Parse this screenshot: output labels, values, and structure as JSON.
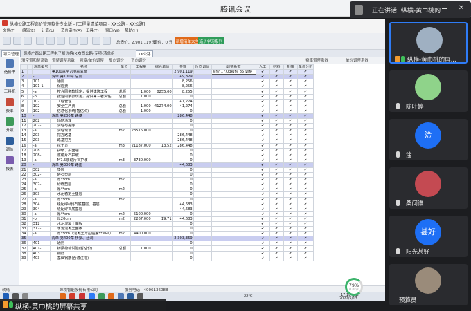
{
  "meeting": {
    "title": "腾讯会议",
    "speaking_label": "正在讲话: 纵横-黄巾桃的..."
  },
  "app": {
    "title": "纵横公路工程造价管理软件专业版 - [工程量清单项目 - XX公路 - XX公路]",
    "menu": [
      "文件(F)",
      "编辑(E)",
      "计算(L)",
      "造价审核(A)",
      "工具(T)",
      "窗口(W)",
      "帮助(H)"
    ],
    "toolbar_total": "总造价：2,901,119 元",
    "toolbar_unit": "调价：0 元",
    "badge_green": "调价助手",
    "badge_orange": "新增清单大全",
    "badge_blue": "造价学习系列",
    "tabs": [
      "项目管理",
      "纵横广西公路工程电子版价格(XX)",
      "广西公路-专项-清单组",
      "XX公路"
    ],
    "filter": [
      "清空调和整系数",
      "调整调整系数",
      "按章/单价调整",
      "反向调价",
      "正向调价"
    ],
    "filter_right": [
      "费率调整系数",
      "单价调整系数"
    ],
    "sidebar": [
      "造价书",
      "工料机",
      "费率",
      "分项",
      "调价",
      "报表"
    ]
  },
  "grid": {
    "headers": [
      "",
      "",
      "清单编号",
      "名称",
      "单位",
      "工程量",
      "综合单价",
      "金额",
      "反向调价",
      "调整系数",
      "人工",
      "材料",
      "机械",
      "单价分析"
    ],
    "adjust_note": "原价   17.03报价   85  调整",
    "rows": [
      {
        "n": "1",
        "code": "",
        "name": "第100章至700章清单",
        "unit": "",
        "qty": "",
        "price": "",
        "amount": "2,901,119",
        "cls": "hl"
      },
      {
        "n": "2",
        "code": "-",
        "name": "清单 第100章 总则",
        "unit": "",
        "qty": "",
        "price": "",
        "amount": "49,829",
        "cls": "sec"
      },
      {
        "n": "3",
        "code": "101",
        "name": "通则",
        "unit": "",
        "qty": "",
        "price": "",
        "amount": "8,256",
        "cls": ""
      },
      {
        "n": "4",
        "code": "101-1",
        "name": "保险费",
        "unit": "",
        "qty": "",
        "price": "",
        "amount": "8,256",
        "cls": ""
      },
      {
        "n": "5",
        "code": "-a",
        "name": "按合同条款规定，提供建筑工程",
        "unit": "总额",
        "qty": "1.000",
        "price": "8255.00",
        "amount": "8,255",
        "cls": ""
      },
      {
        "n": "6",
        "code": "-b",
        "name": "按合同条款规定，提供第三者责任",
        "unit": "总额",
        "qty": "1.000",
        "price": "",
        "amount": "0",
        "cls": ""
      },
      {
        "n": "7",
        "code": "102",
        "name": "工程管理",
        "unit": "",
        "qty": "",
        "price": "",
        "amount": "41,274",
        "cls": ""
      },
      {
        "n": "8",
        "code": "102-",
        "name": "安全生产费",
        "unit": "总额",
        "qty": "1.000",
        "price": "41274.00",
        "amount": "41,274",
        "cls": ""
      },
      {
        "n": "9",
        "code": "102-",
        "name": "信息化系统(暂估价)",
        "unit": "总额",
        "qty": "1.000",
        "price": "",
        "amount": "0",
        "cls": ""
      },
      {
        "n": "10",
        "code": "-",
        "name": "清单 第200章 路基",
        "unit": "",
        "qty": "",
        "price": "",
        "amount": "286,448",
        "cls": "sec"
      },
      {
        "n": "11",
        "code": "202",
        "name": "场地清理",
        "unit": "",
        "qty": "",
        "price": "",
        "amount": "0",
        "cls": ""
      },
      {
        "n": "12",
        "code": "202-",
        "name": "清理与掘除",
        "unit": "",
        "qty": "",
        "price": "",
        "amount": "0",
        "cls": ""
      },
      {
        "n": "13",
        "code": "-a",
        "name": "清理现场",
        "unit": "m2",
        "qty": "23516.000",
        "price": "",
        "amount": "0",
        "cls": ""
      },
      {
        "n": "14",
        "code": "203",
        "name": "挖方路基",
        "unit": "",
        "qty": "",
        "price": "",
        "amount": "286,448",
        "cls": ""
      },
      {
        "n": "15",
        "code": "203-",
        "name": "路基挖方",
        "unit": "",
        "qty": "",
        "price": "",
        "amount": "286,448",
        "cls": ""
      },
      {
        "n": "16",
        "code": "-a",
        "name": "挖土方",
        "unit": "m3",
        "qty": "21187.000",
        "price": "13.52",
        "amount": "286,448",
        "cls": ""
      },
      {
        "n": "17",
        "code": "208",
        "name": "护坡、护面墙",
        "unit": "",
        "qty": "",
        "price": "",
        "amount": "0",
        "cls": ""
      },
      {
        "n": "18",
        "code": "208-",
        "name": "浆砌片石护坡",
        "unit": "",
        "qty": "",
        "price": "",
        "amount": "0",
        "cls": ""
      },
      {
        "n": "19",
        "code": "-a",
        "name": "M7.5浆砌片石护坡",
        "unit": "m3",
        "qty": "3730.000",
        "price": "",
        "amount": "0",
        "cls": ""
      },
      {
        "n": "20",
        "code": "-",
        "name": "清单 第300章 路面",
        "unit": "",
        "qty": "",
        "price": "",
        "amount": "44,683",
        "cls": "sec"
      },
      {
        "n": "21",
        "code": "302",
        "name": "垫层",
        "unit": "",
        "qty": "",
        "price": "",
        "amount": "0",
        "cls": ""
      },
      {
        "n": "22",
        "code": "302-",
        "name": "碎石垫层",
        "unit": "",
        "qty": "",
        "price": "",
        "amount": "0",
        "cls": ""
      },
      {
        "n": "23",
        "code": "-a",
        "name": "厚**cm",
        "unit": "m2",
        "qty": "",
        "price": "",
        "amount": "0",
        "cls": ""
      },
      {
        "n": "24",
        "code": "302-",
        "name": "砂砾垫层",
        "unit": "",
        "qty": "",
        "price": "",
        "amount": "0",
        "cls": ""
      },
      {
        "n": "25",
        "code": "-a",
        "name": "厚**cm",
        "unit": "m2",
        "qty": "",
        "price": "",
        "amount": "0",
        "cls": ""
      },
      {
        "n": "26",
        "code": "303",
        "name": "水泥稳定土垫层",
        "unit": "",
        "qty": "",
        "price": "",
        "amount": "0",
        "cls": ""
      },
      {
        "n": "27",
        "code": "-a",
        "name": "厚**cm",
        "unit": "m2",
        "qty": "",
        "price": "",
        "amount": "0",
        "cls": ""
      },
      {
        "n": "28",
        "code": "304",
        "name": "级配碎(砾)石底基层、基层",
        "unit": "",
        "qty": "",
        "price": "",
        "amount": "44,683",
        "cls": ""
      },
      {
        "n": "29",
        "code": "304-",
        "name": "级配碎石底基层",
        "unit": "",
        "qty": "",
        "price": "",
        "amount": "44,683",
        "cls": ""
      },
      {
        "n": "30",
        "code": "-a",
        "name": "厚**cm",
        "unit": "m2",
        "qty": "5100.000",
        "price": "",
        "amount": "0",
        "cls": ""
      },
      {
        "n": "31",
        "code": "-b",
        "name": "厚20cm",
        "unit": "m2",
        "qty": "2267.000",
        "price": "19.71",
        "amount": "44,683",
        "cls": ""
      },
      {
        "n": "32",
        "code": "312",
        "name": "水泥混凝土面板",
        "unit": "",
        "qty": "",
        "price": "",
        "amount": "0",
        "cls": ""
      },
      {
        "n": "33",
        "code": "312-",
        "name": "水泥混凝土面板",
        "unit": "",
        "qty": "",
        "price": "",
        "amount": "0",
        "cls": ""
      },
      {
        "n": "34",
        "code": "-a",
        "name": "厚**cm（混凝土弯拉强度**MPa）",
        "unit": "m2",
        "qty": "4400.000",
        "price": "",
        "amount": "0",
        "cls": ""
      },
      {
        "n": "35",
        "code": "-",
        "name": "清单 第400章 桥梁、涵洞",
        "unit": "",
        "qty": "",
        "price": "",
        "amount": "2,303,359",
        "cls": "sec"
      },
      {
        "n": "36",
        "code": "401",
        "name": "通则",
        "unit": "",
        "qty": "",
        "price": "",
        "amount": "0",
        "cls": ""
      },
      {
        "n": "37",
        "code": "401-",
        "name": "桥梁荷载试验(暂估价)",
        "unit": "总额",
        "qty": "1.000",
        "price": "",
        "amount": "0",
        "cls": ""
      },
      {
        "n": "38",
        "code": "403",
        "name": "钢筋",
        "unit": "",
        "qty": "",
        "price": "",
        "amount": "0",
        "cls": ""
      },
      {
        "n": "39",
        "code": "403-",
        "name": "基础钢筋(含灌注桩)",
        "unit": "",
        "qty": "",
        "price": "",
        "amount": "0",
        "cls": ""
      }
    ]
  },
  "status": {
    "left": "就绪",
    "company": "纵横智能股份有限公司",
    "phone": "服务电话：4006136088"
  },
  "taskbar": {
    "weather": "22°C",
    "time": "17:18 周日",
    "date": "2022/5/13"
  },
  "gauge": {
    "value": "79%",
    "rate": "0.0k/s"
  },
  "footer": {
    "name": "纵横-黄巾桃的屏幕共享"
  },
  "participants": [
    {
      "name": "纵横-黄巾桃的屏...",
      "initial": "",
      "color": "#9fb0c2",
      "active": true
    },
    {
      "name": "陈叶婷",
      "initial": "",
      "color": "#8fd38a",
      "active": false
    },
    {
      "name": "淦",
      "initial": "淦",
      "color": "#1e6ff5",
      "active": false
    },
    {
      "name": "桑问谁",
      "initial": "",
      "color": "#c44a52",
      "active": false
    },
    {
      "name": "阳光甚好",
      "initial": "甚好",
      "color": "#1e6ff5",
      "active": false
    },
    {
      "name": "预算员",
      "initial": "",
      "color": "#9a8b7a",
      "active": false
    }
  ]
}
